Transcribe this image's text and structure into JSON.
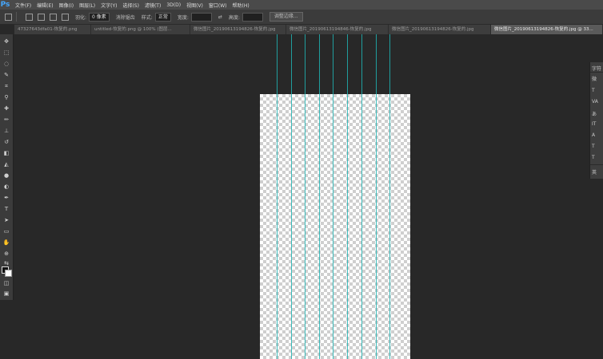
{
  "app": {
    "logo": "Ps"
  },
  "menu": [
    "文件(F)",
    "编辑(E)",
    "图像(I)",
    "图层(L)",
    "文字(Y)",
    "选择(S)",
    "滤镜(T)",
    "3D(D)",
    "视图(V)",
    "窗口(W)",
    "帮助(H)"
  ],
  "options_bar": {
    "feather_label": "羽化:",
    "feather_value": "0 像素",
    "antialias_label": "消除锯齿",
    "style_label": "样式:",
    "style_value": "正常",
    "width_label": "宽度:",
    "height_label": "高度:",
    "refine_edge_button": "调整边缘..."
  },
  "tabs": [
    {
      "label": "47327643dfa01-恢复的.png"
    },
    {
      "label": "untitled-恢复的.png @ 100% (图层..."
    },
    {
      "label": "微信图片_20190613194826-恢复的.jpg"
    },
    {
      "label": "微信图片_20190613194846-恢复的.jpg"
    },
    {
      "label": "微信图片_20190613194826-恢复的.jpg"
    },
    {
      "label": "微信图片_20190613194826-恢复的.jpg @ 33..."
    }
  ],
  "right_panel": {
    "title": "字符",
    "rows": [
      "微",
      "T",
      "VA",
      "あ",
      "IT",
      "A",
      "T",
      "T",
      "英"
    ]
  },
  "canvas": {
    "fill": "transparent"
  },
  "colors": {
    "guide": "#1fb3b3",
    "accent": "#45a8ff"
  }
}
